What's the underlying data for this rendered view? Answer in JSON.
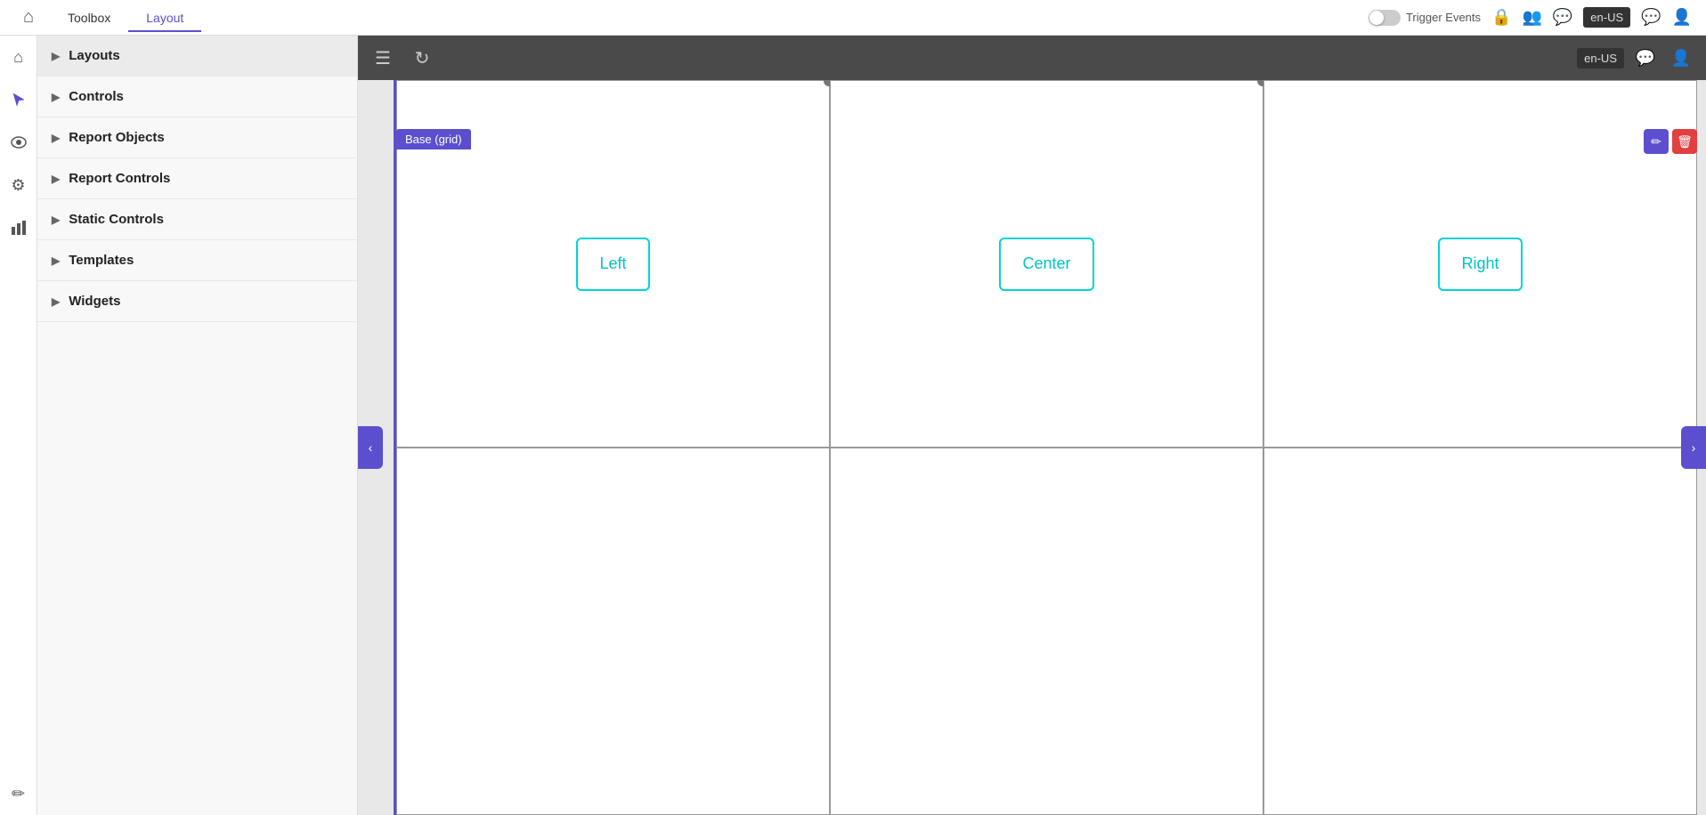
{
  "topNav": {
    "homeIcon": "⌂",
    "tabs": [
      {
        "id": "toolbox",
        "label": "Toolbox",
        "active": false
      },
      {
        "id": "layout",
        "label": "Layout",
        "active": true
      }
    ],
    "triggerEventsLabel": "Trigger Events",
    "langBadge": "en-US",
    "icons": {
      "lock": "🔒",
      "users": "👥",
      "chat": "💬",
      "user": "👤"
    }
  },
  "iconRail": {
    "icons": [
      {
        "id": "home",
        "symbol": "⌂",
        "active": false
      },
      {
        "id": "pointer",
        "symbol": "⊕",
        "active": false
      },
      {
        "id": "eye",
        "symbol": "👁",
        "active": false
      },
      {
        "id": "settings",
        "symbol": "⚙",
        "active": false
      },
      {
        "id": "chart",
        "symbol": "📊",
        "active": false
      }
    ],
    "bottomIcon": {
      "id": "pen",
      "symbol": "✏"
    }
  },
  "sidebar": {
    "items": [
      {
        "id": "layouts",
        "label": "Layouts",
        "active": true
      },
      {
        "id": "controls",
        "label": "Controls",
        "active": false
      },
      {
        "id": "report-objects",
        "label": "Report Objects",
        "active": false
      },
      {
        "id": "report-controls",
        "label": "Report Controls",
        "active": false
      },
      {
        "id": "static-controls",
        "label": "Static Controls",
        "active": false
      },
      {
        "id": "templates",
        "label": "Templates",
        "active": false
      },
      {
        "id": "widgets",
        "label": "Widgets",
        "active": false
      }
    ]
  },
  "canvas": {
    "toolbar": {
      "menuIcon": "☰",
      "refreshIcon": "↻"
    },
    "baseLabel": "Base (grid)",
    "collapseLeft": "‹",
    "collapseRight": "›",
    "editIcon": "✏",
    "deleteIcon": "🗑",
    "cards": [
      {
        "id": "left",
        "label": "Left"
      },
      {
        "id": "center",
        "label": "Center"
      },
      {
        "id": "right",
        "label": "Right"
      }
    ]
  }
}
